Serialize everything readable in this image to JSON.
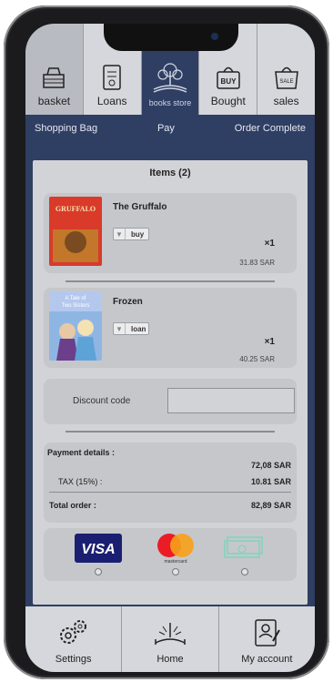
{
  "top_nav": {
    "tabs": [
      {
        "label": "basket",
        "icon": "basket-icon"
      },
      {
        "label": "Loans",
        "icon": "loan-card-icon"
      },
      {
        "label": "books store",
        "icon": "book-tree-icon"
      },
      {
        "label": "Bought",
        "icon": "buy-bag-icon"
      },
      {
        "label": "sales",
        "icon": "sale-bag-icon"
      }
    ]
  },
  "steps": [
    "Shopping Bag",
    "Pay",
    "Order Complete"
  ],
  "cart": {
    "title": "Items (2)",
    "items": [
      {
        "title": "The Gruffalo",
        "option": "buy",
        "qty": "×1",
        "price": "31.83 SAR"
      },
      {
        "title": "Frozen",
        "option": "loan",
        "qty": "×1",
        "price": "40.25 SAR"
      }
    ]
  },
  "discount": {
    "label": "Discount code",
    "value": ""
  },
  "payment": {
    "heading": "Payment details :",
    "subtotal": "72,08 SAR",
    "tax_label": "TAX (15%) :",
    "tax_value": "10.81 SAR",
    "total_label": "Total order :",
    "total_value": "82,89 SAR"
  },
  "methods": [
    {
      "name": "VISA",
      "icon": "visa-icon"
    },
    {
      "name": "mastercard",
      "icon": "mastercard-icon"
    },
    {
      "name": "cash",
      "icon": "cash-icon"
    }
  ],
  "bottom_nav": {
    "tabs": [
      {
        "label": "Settings",
        "icon": "gears-icon"
      },
      {
        "label": "Home",
        "icon": "open-book-icon"
      },
      {
        "label": "My account",
        "icon": "account-icon"
      }
    ]
  },
  "colors": {
    "navy": "#2f3e63",
    "panel": "#d2d3d6",
    "card": "#c6c7cb",
    "visa": "#1a1f71"
  }
}
